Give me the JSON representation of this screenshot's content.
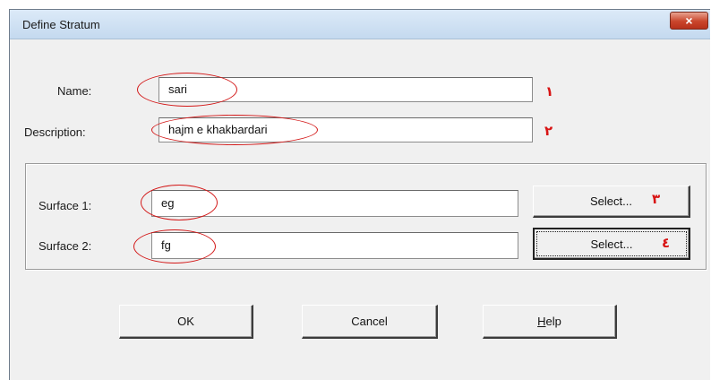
{
  "window": {
    "title": "Define Stratum",
    "close_label": "×"
  },
  "form": {
    "name_label": "Name:",
    "name_value": "sari",
    "description_label": "Description:",
    "description_value": "hajm e khakbardari"
  },
  "surfaces": {
    "surface1_label": "Surface 1:",
    "surface1_value": "eg",
    "surface1_button": "Select...",
    "surface2_label": "Surface 2:",
    "surface2_value": "fg",
    "surface2_button": "Select..."
  },
  "buttons": {
    "ok": "OK",
    "cancel": "Cancel",
    "help_prefix": "",
    "help_accel": "H",
    "help_rest": "elp"
  },
  "annotations": {
    "mark_1": "١",
    "mark_2": "٢",
    "mark_3": "٣",
    "mark_4": "٤",
    "color": "#d31818"
  }
}
